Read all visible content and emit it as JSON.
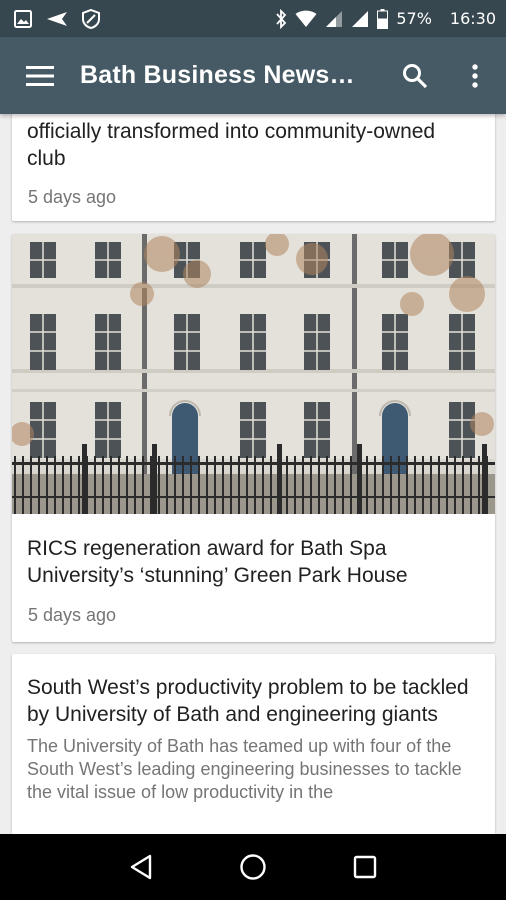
{
  "status_bar": {
    "icons_left": [
      "image-icon",
      "send-icon",
      "vpn-shield-icon"
    ],
    "icons_right": [
      "bluetooth-icon",
      "wifi-icon",
      "signal-icon",
      "signal-icon",
      "battery-icon"
    ],
    "battery": "57%",
    "time": "16:30"
  },
  "app_bar": {
    "title": "Bath Business News…",
    "color": "#455a64"
  },
  "articles": [
    {
      "title_line1": "officially transformed into community-owned",
      "title_line2": "club",
      "time": "5 days ago"
    },
    {
      "image": "georgian-terrace-photo",
      "title": "RICS regeneration award for Bath Spa University’s ‘stunning’ Green Park House",
      "time": "5 days ago"
    },
    {
      "title": "South West’s productivity problem to be tackled by University of Bath and engineering giants",
      "snippet": "The University of Bath has teamed up with four of the South West’s leading engineering businesses to tackle the vital issue of low productivity in the"
    }
  ],
  "nav_bar": {
    "buttons": [
      "back-icon",
      "home-icon",
      "recents-icon"
    ]
  }
}
